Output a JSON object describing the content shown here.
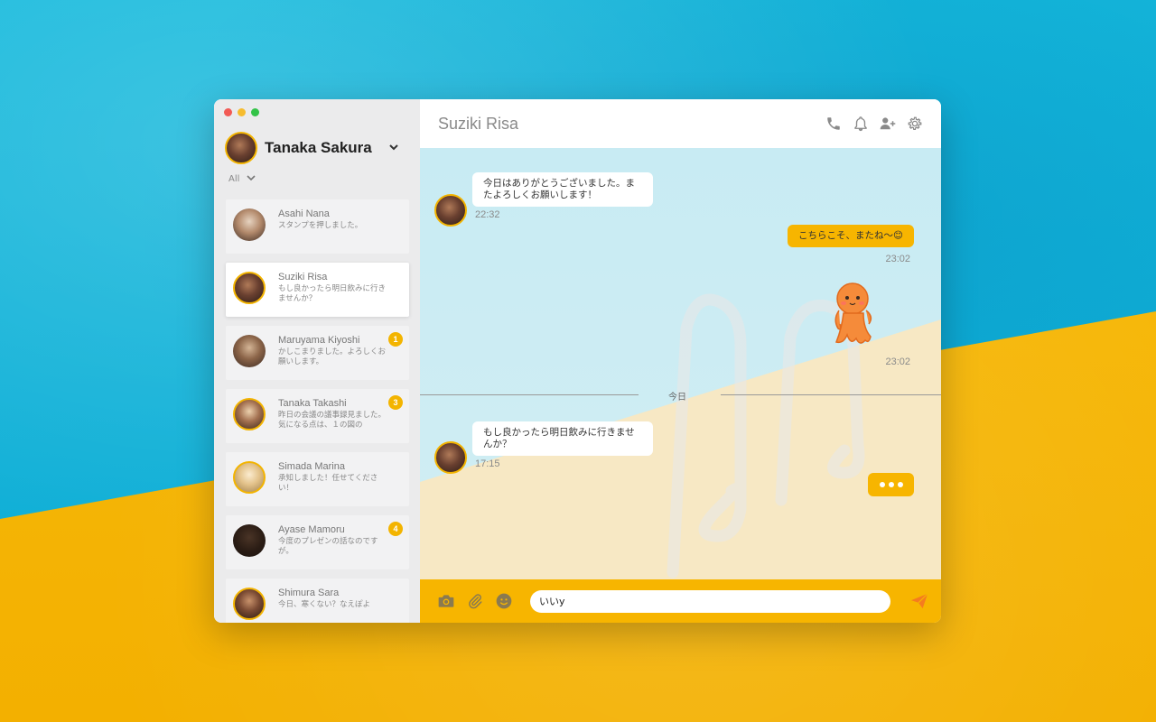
{
  "user": {
    "name": "Tanaka Sakura"
  },
  "filter": {
    "label": "All"
  },
  "contacts": [
    {
      "name": "Asahi Nana",
      "preview": "スタンプを押しました。",
      "badge": "",
      "color1": "#d9c9b7",
      "color2": "#7a5040"
    },
    {
      "name": "Suziki Risa",
      "preview": "もし良かったら明日飲みに行きませんか？",
      "badge": "",
      "color1": "#b07a58",
      "color2": "#2d1d17"
    },
    {
      "name": "Maruyama Kiyoshi",
      "preview": "かしこまりました。よろしくお願いします。",
      "badge": "1",
      "color1": "#c7a58a",
      "color2": "#5a3a2a"
    },
    {
      "name": "Tanaka Takashi",
      "preview": "昨日の会議の議事録見ました。気になる点は、１の図の",
      "badge": "3",
      "color1": "#e2c39f",
      "color2": "#7a4a33"
    },
    {
      "name": "Simada Marina",
      "preview": "承知しました！任せてください！",
      "badge": "",
      "color1": "#f2dfb5",
      "color2": "#c9a46a"
    },
    {
      "name": "Ayase Mamoru",
      "preview": "今度のプレゼンの話なのですが。",
      "badge": "4",
      "color1": "#4a3426",
      "color2": "#1c1410"
    },
    {
      "name": "Shimura Sara",
      "preview": "今日、寒くない？なえぽよ",
      "badge": "",
      "color1": "#b4805e",
      "color2": "#3a2418"
    }
  ],
  "chat": {
    "title": "Suziki Risa",
    "messages": [
      {
        "text": "今日はありがとうございました。またよろしくお願いします！",
        "time": "22:32"
      },
      {
        "text": "こちらこそ、またね〜😊",
        "time": "23:02"
      },
      {
        "sticker": "octopus-sticker",
        "time": "23:02"
      },
      {
        "text": "もし良かったら明日飲みに行きませんか？",
        "time": "17:15"
      }
    ],
    "divider_label": "今日"
  },
  "composer": {
    "value": "いいy"
  },
  "colors": {
    "accent": "#f7b500",
    "sidebar": "#ebebec",
    "chat_bg": "#c8ebf3"
  },
  "icons": [
    "phone-icon",
    "bell-icon",
    "add-user-icon",
    "gear-icon",
    "camera-icon",
    "paperclip-icon",
    "smiley-icon",
    "send-icon"
  ]
}
